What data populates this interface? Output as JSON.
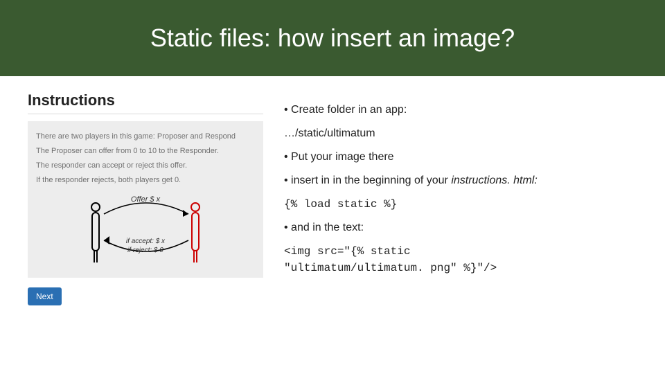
{
  "slide": {
    "title": "Static files: how insert an image?"
  },
  "left": {
    "heading": "Instructions",
    "body": {
      "line1": "There are two players in this game: Proposer and Respond",
      "line2": "The Proposer can offer from 0 to 10 to the Responder.",
      "line3": "The responder can accept or reject this offer.",
      "line4": "If the responder rejects, both players get 0."
    },
    "diagram": {
      "offer_label": "Offer $ x",
      "accept_label": "if accept: $ x",
      "reject_label": "if reject: $ 0"
    },
    "next_label": "Next"
  },
  "right": {
    "b1": "Create folder in an app:",
    "path": "…/static/ultimatum",
    "b2": "Put your image there",
    "b3_prefix": "insert in in the beginning of your ",
    "b3_ital": "instructions. html:",
    "code1": "{% load static  %}",
    "b4": "and in the text:",
    "code2a": "<img src=\"{% static",
    "code2b": "\"ultimatum/ultimatum. png\" %}\"/>"
  }
}
